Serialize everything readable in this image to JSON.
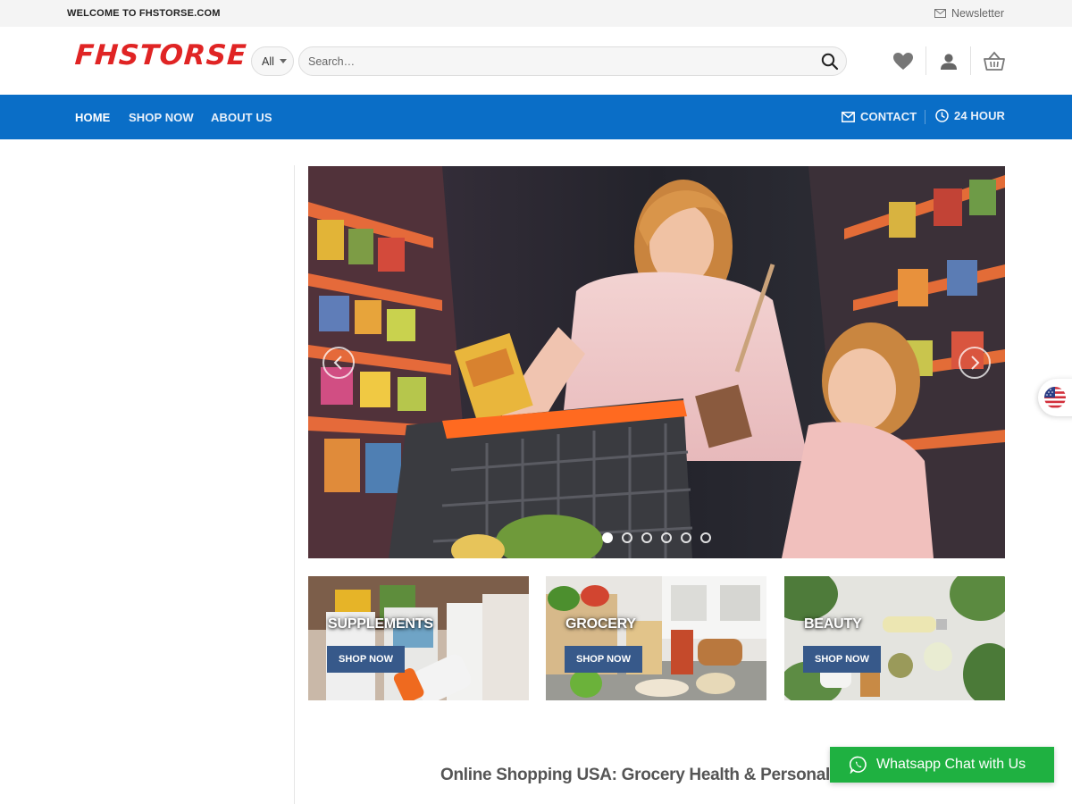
{
  "topbar": {
    "welcome": "WELCOME TO FHSTORSE.COM",
    "newsletter": "Newsletter"
  },
  "header": {
    "logo": "FHSTORSE",
    "category_selected": "All",
    "search_placeholder": "Search…",
    "icons": [
      "heart-icon",
      "user-icon",
      "basket-icon"
    ]
  },
  "nav": {
    "items": [
      {
        "label": "HOME",
        "active": true
      },
      {
        "label": "SHOP NOW",
        "active": false
      },
      {
        "label": "ABOUT US",
        "active": false
      }
    ],
    "right": {
      "contact": "CONTACT",
      "hours": "24 HOUR"
    },
    "color": "#0a6ec7"
  },
  "hero": {
    "slide_count": 6,
    "active_slide": 1
  },
  "categories": [
    {
      "title": "SUPPLEMENTS",
      "button": "SHOP NOW"
    },
    {
      "title": "GROCERY",
      "button": "SHOP NOW"
    },
    {
      "title": "BEAUTY",
      "button": "SHOP NOW"
    }
  ],
  "tagline": "Online Shopping USA: Grocery Health & Personal Care",
  "whatsapp": {
    "label": "Whatsapp Chat with Us",
    "color": "#1fb141"
  },
  "colors": {
    "logo": "#e02424",
    "button": "#37598a"
  }
}
